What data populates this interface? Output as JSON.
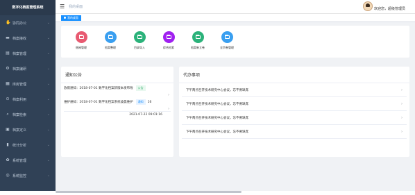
{
  "app": {
    "title": "数字化档案管理系统"
  },
  "sidebar": {
    "items": [
      {
        "label": "协同办公",
        "icon": "handshake-icon",
        "glyph": "✋"
      },
      {
        "label": "档案接收",
        "icon": "folder-icon",
        "glyph": "▬"
      },
      {
        "label": "档案管理",
        "icon": "document-icon",
        "glyph": "▤"
      },
      {
        "label": "档案编研",
        "icon": "gear-small-icon",
        "glyph": "⚙"
      },
      {
        "label": "库房管理",
        "icon": "warehouse-icon",
        "glyph": "▦"
      },
      {
        "label": "档案利用",
        "icon": "link-icon",
        "glyph": "⊙"
      },
      {
        "label": "档案检索",
        "icon": "search-icon",
        "glyph": "⌕"
      },
      {
        "label": "档案定义",
        "icon": "book-icon",
        "glyph": "▣"
      },
      {
        "label": "统计分析",
        "icon": "chart-icon",
        "glyph": "▮"
      },
      {
        "label": "系统管理",
        "icon": "settings-icon",
        "glyph": "✿"
      },
      {
        "label": "系统监控",
        "icon": "monitor-icon",
        "glyph": "◎"
      }
    ]
  },
  "header": {
    "breadcrumb": "我的桌面",
    "welcome": "欢迎您，超级管理员"
  },
  "tabs": [
    {
      "label": "我的桌面"
    }
  ],
  "quick_actions": [
    {
      "label": "借阅管理",
      "color": "#e85a71"
    },
    {
      "label": "档案整理",
      "color": "#3a9ff0"
    },
    {
      "label": "目录导入",
      "color": "#2bb27a"
    },
    {
      "label": "综合检索",
      "color": "#a020f0"
    },
    {
      "label": "档案新立卷",
      "color": "#2bb27a"
    },
    {
      "label": "全宗卷管理",
      "color": "#3a9ff0"
    }
  ],
  "notice": {
    "title": "通知公告",
    "items": [
      {
        "text": "放假通知：2018-07-01 数字化档案新版本发布啦",
        "badge": "公告"
      },
      {
        "text": "维护通知：2018-07-01 数字化档案系统凌晨维护",
        "badge": "通知",
        "suffix": "16"
      }
    ],
    "date": "2021-07-22 09:01:16"
  },
  "todo": {
    "title": "代办事项",
    "items": [
      "下午两点召开技术研究中心会议，忘不要缺席",
      "下午两点召开技术研究中心会议，忘不要缺席",
      "下午两点召开技术研究中心会议，忘不要缺席",
      "下午两点召开技术研究中心会议，忘不要缺席"
    ]
  }
}
